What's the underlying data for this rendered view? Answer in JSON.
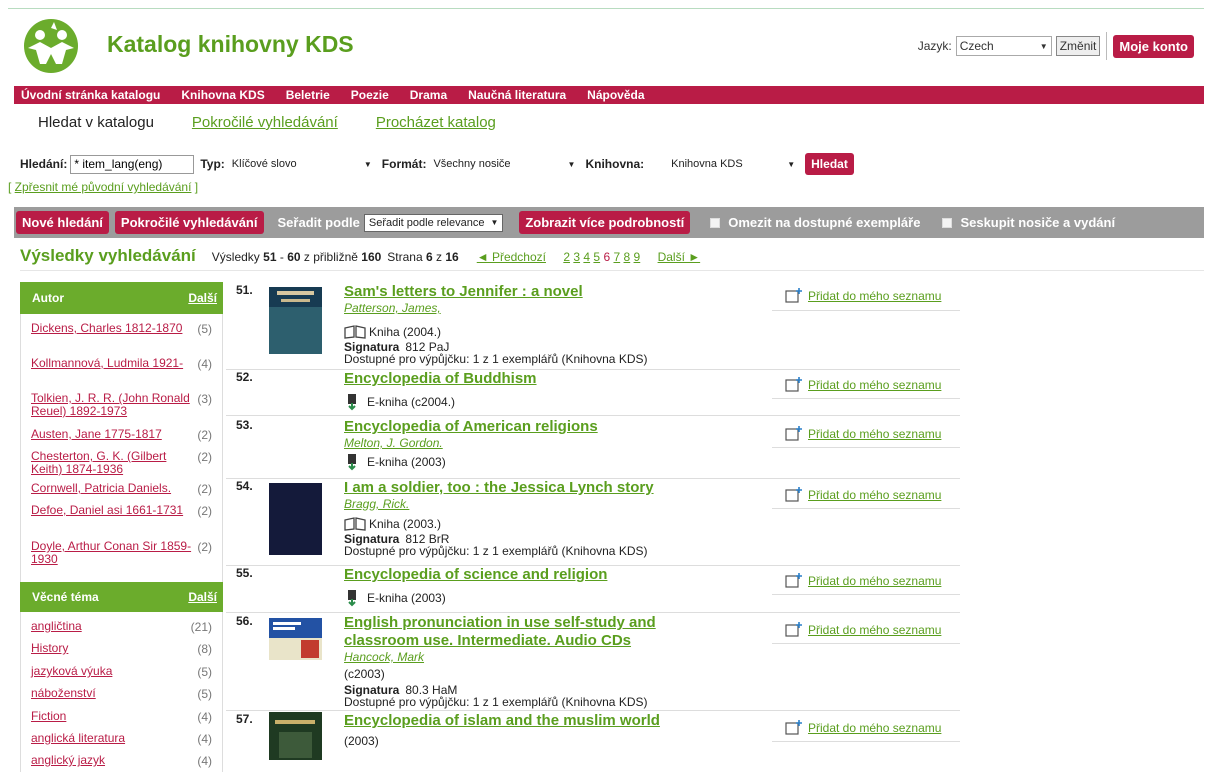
{
  "header": {
    "site_title": "Katalog knihovny KDS",
    "language_label": "Jazyk:",
    "language_value": "Czech",
    "change_button": "Změnit",
    "account_button": "Moje konto"
  },
  "nav": [
    "Úvodní stránka katalogu",
    "Knihovna KDS",
    "Beletrie",
    "Poezie",
    "Drama",
    "Naučná literatura",
    "Nápověda"
  ],
  "search_tabs": {
    "active": "Hledat v katalogu",
    "advanced": "Pokročilé vyhledávání",
    "browse": "Procházet katalog"
  },
  "search": {
    "query_label": "Hledání:",
    "query_value": "* item_lang(eng)",
    "type_label": "Typ:",
    "type_value": "Klíčové slovo",
    "format_label": "Formát:",
    "format_value": "Všechny nosiče",
    "library_label": "Knihovna:",
    "library_value": "Knihovna KDS",
    "submit": "Hledat",
    "refine": "Zpřesnit mé původní vyhledávání"
  },
  "toolbar": {
    "new_search": "Nové hledání",
    "advanced": "Pokročilé vyhledávání",
    "sort_label": "Seřadit podle",
    "sort_value": "Seřadit podle relevance",
    "more_details": "Zobrazit více podrobností",
    "limit_available": "Omezit na dostupné exempláře",
    "group_formats": "Seskupit nosiče a vydání"
  },
  "results_header": {
    "title": "Výsledky vyhledávání",
    "label": "Výsledky",
    "range_start": "51",
    "range_end": "60",
    "approx_text": "z přibližně",
    "total": "160",
    "page_label": "Strana",
    "page_current": "6",
    "page_of": "z",
    "page_total": "16",
    "prev": "◄ Předchozí",
    "pages": [
      "2",
      "3",
      "4",
      "5",
      "6",
      "7",
      "8",
      "9"
    ],
    "next": "Další ►"
  },
  "facets": {
    "author": {
      "title": "Autor",
      "more": "Další",
      "items": [
        {
          "name": "Dickens, Charles 1812-1870",
          "count": "(5)"
        },
        {
          "name": "Kollmannová, Ludmila 1921-",
          "count": "(4)"
        },
        {
          "name": "Tolkien, J. R. R. (John Ronald Reuel) 1892-1973",
          "count": "(3)"
        },
        {
          "name": "Austen, Jane 1775-1817",
          "count": "(2)"
        },
        {
          "name": "Chesterton, G. K. (Gilbert Keith) 1874-1936",
          "count": "(2)"
        },
        {
          "name": "Cornwell, Patricia Daniels.",
          "count": "(2)"
        },
        {
          "name": "Defoe, Daniel asi 1661-1731",
          "count": "(2)"
        },
        {
          "name": "Doyle, Arthur Conan Sir 1859-1930",
          "count": "(2)"
        }
      ]
    },
    "subject": {
      "title": "Věcné téma",
      "more": "Další",
      "items": [
        {
          "name": "angličtina",
          "count": "(21)"
        },
        {
          "name": "History",
          "count": "(8)"
        },
        {
          "name": "jazyková výuka",
          "count": "(5)"
        },
        {
          "name": "náboženství",
          "count": "(5)"
        },
        {
          "name": "Fiction",
          "count": "(4)"
        },
        {
          "name": "anglická literatura",
          "count": "(4)"
        },
        {
          "name": "anglický jazyk",
          "count": "(4)"
        }
      ]
    }
  },
  "results": [
    {
      "num": "51.",
      "title": "Sam's letters to Jennifer : a novel",
      "author": "Patterson, James,",
      "format": "Kniha (2004.)",
      "sig_label": "Signatura",
      "sig": "812 PaJ",
      "avail": "Dostupné pro výpůjčku: 1 z 1 exemplářů (Knihovna KDS)"
    },
    {
      "num": "52.",
      "title": "Encyclopedia of Buddhism",
      "format": "E-kniha (c2004.)"
    },
    {
      "num": "53.",
      "title": "Encyclopedia of American religions",
      "author": "Melton, J. Gordon.",
      "format": "E-kniha (2003)"
    },
    {
      "num": "54.",
      "title": "I am a soldier, too : the Jessica Lynch story",
      "author": "Bragg, Rick.",
      "format": "Kniha (2003.)",
      "sig_label": "Signatura",
      "sig": "812 BrR",
      "avail": "Dostupné pro výpůjčku: 1 z 1 exemplářů (Knihovna KDS)"
    },
    {
      "num": "55.",
      "title": "Encyclopedia of science and religion",
      "format": "E-kniha (2003)"
    },
    {
      "num": "56.",
      "title_l1": "English pronunciation in use self-study and",
      "title_l2": "classroom use. Intermediate. Audio CDs",
      "author": "Hancock, Mark",
      "format": "(c2003)",
      "sig_label": "Signatura",
      "sig": "80.3 HaM",
      "avail": "Dostupné pro výpůjčku: 1 z 1 exemplářů (Knihovna KDS)"
    },
    {
      "num": "57.",
      "title": "Encyclopedia of islam and the muslim world",
      "format": "(2003)"
    }
  ],
  "add_to_list": "Přidat do mého seznamu",
  "colors": {
    "brand_red": "#b91c46",
    "brand_green": "#5a9e1e",
    "facet_green": "#6bac2c",
    "toolbar_gray": "#9c9c9c"
  }
}
